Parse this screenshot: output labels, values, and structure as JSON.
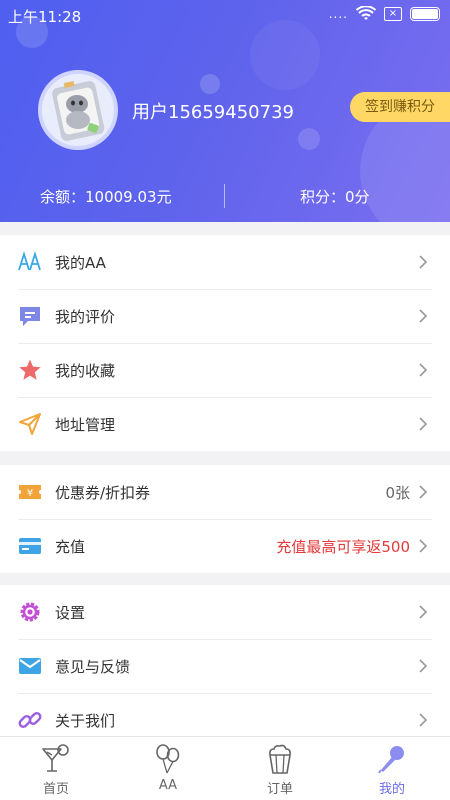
{
  "status_bar": {
    "time": "上午11:28",
    "signal": "....",
    "sim_label": "×"
  },
  "profile": {
    "username": "用户15659450739",
    "checkin_label": "签到赚积分",
    "balance": "余额：10009.03元",
    "points": "积分：0分"
  },
  "menu_group_1": [
    {
      "label": "我的AA",
      "icon": "aa-icon"
    },
    {
      "label": "我的评价",
      "icon": "comment-icon"
    },
    {
      "label": "我的收藏",
      "icon": "star-icon"
    },
    {
      "label": "地址管理",
      "icon": "location-arrow-icon"
    }
  ],
  "menu_group_2": [
    {
      "label": "优惠券/折扣券",
      "value": "0张",
      "icon": "coupon-icon"
    },
    {
      "label": "充值",
      "value": "充值最高可享返500",
      "icon": "card-icon"
    }
  ],
  "menu_group_3": [
    {
      "label": "设置",
      "icon": "gear-icon"
    },
    {
      "label": "意见与反馈",
      "icon": "mail-icon"
    },
    {
      "label": "关于我们",
      "icon": "link-icon"
    }
  ],
  "tabs": [
    {
      "label": "首页",
      "icon": "cocktail-icon"
    },
    {
      "label": "AA",
      "icon": "balloons-icon"
    },
    {
      "label": "订单",
      "icon": "popcorn-icon"
    },
    {
      "label": "我的",
      "icon": "microphone-icon"
    }
  ],
  "colors": {
    "header_gradient_start": "#4f5ff0",
    "header_gradient_end": "#7b6ef0",
    "checkin_button": "#ffd764",
    "promo_text": "#e33b3b",
    "active_tab": "#6b6de6"
  }
}
